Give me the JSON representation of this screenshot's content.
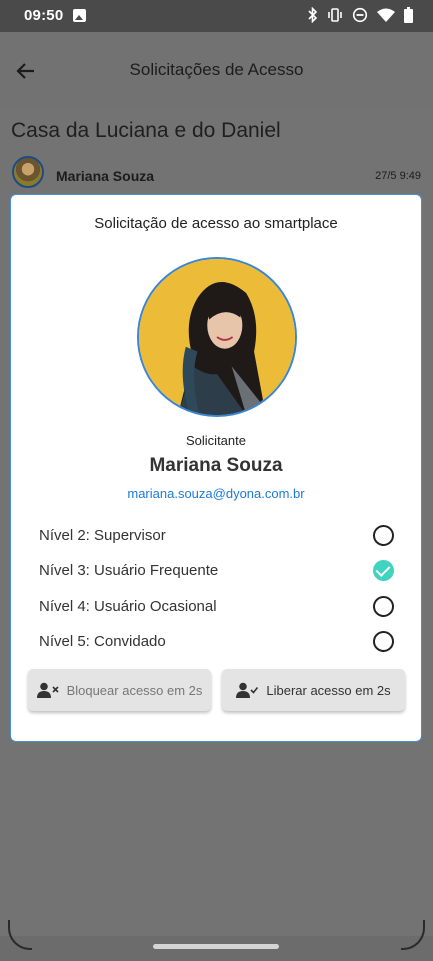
{
  "status_bar": {
    "time": "09:50"
  },
  "appbar": {
    "title": "Solicitações de Acesso"
  },
  "background": {
    "place_title": "Casa da Luciana e do Daniel",
    "request_name": "Mariana Souza",
    "request_time": "27/5 9:49"
  },
  "dialog": {
    "title": "Solicitação de acesso ao smartplace",
    "requester_label": "Solicitante",
    "requester_name": "Mariana Souza",
    "requester_email": "mariana.souza@dyona.com.br",
    "levels": [
      {
        "label": "Nível 2: Supervisor",
        "selected": false
      },
      {
        "label": "Nível 3: Usuário Frequente",
        "selected": true
      },
      {
        "label": "Nível 4: Usuário Ocasional",
        "selected": false
      },
      {
        "label": "Nível 5: Convidado",
        "selected": false
      }
    ],
    "block_button": "Bloquear acesso em 2s",
    "allow_button": "Liberar acesso em 2s"
  },
  "colors": {
    "accent_blue": "#3a86d6",
    "check_teal": "#3fd3c0",
    "email_blue": "#1e7ad8"
  },
  "icons": [
    "arrow-back-icon",
    "bluetooth-icon",
    "vibrate-icon",
    "dnd-icon",
    "wifi-icon",
    "battery-icon",
    "image-icon",
    "user-remove-icon",
    "user-check-icon"
  ]
}
